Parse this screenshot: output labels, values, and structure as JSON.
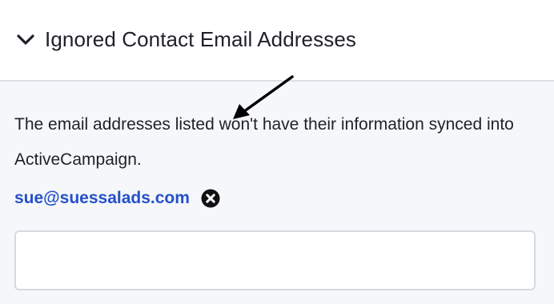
{
  "section": {
    "title": "Ignored Contact Email Addresses",
    "expanded": true,
    "chevron_icon": "chevron-down-icon"
  },
  "description": "The email addresses listed won't have their information synced into ActiveCampaign.",
  "ignored_emails": [
    {
      "address": "sue@suessalads.com",
      "remove_icon": "close-circle-icon"
    }
  ],
  "new_email_input": {
    "value": "",
    "placeholder": ""
  },
  "colors": {
    "link": "#2550c7",
    "text": "#1f2129",
    "body_background": "#f5f7fa",
    "divider": "#dcdfe6"
  }
}
